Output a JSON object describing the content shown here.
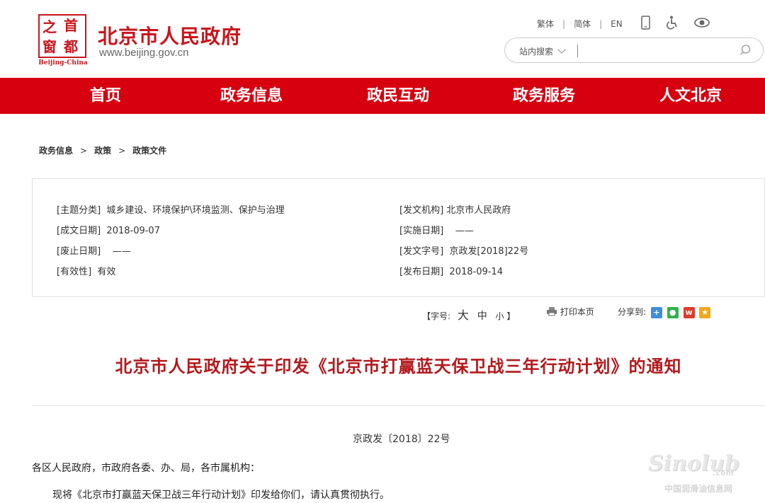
{
  "header": {
    "logo": {
      "char_1": "之",
      "char_2": "首",
      "char_3": "窗",
      "char_4": "都",
      "en": "Beijing-China"
    },
    "title": "北京市人民政府",
    "url": "www.beijing.gov.cn",
    "links": {
      "traditional": "繁体",
      "simplified": "简体",
      "english": "EN"
    },
    "icons": [
      "mobile-icon",
      "accessibility-icon",
      "eye-icon"
    ],
    "search": {
      "scope": "站内搜索",
      "value": "",
      "placeholder": ""
    }
  },
  "nav": {
    "items": [
      "首页",
      "政务信息",
      "政民互动",
      "政务服务",
      "人文北京"
    ]
  },
  "breadcrumb": [
    "政务信息",
    "政策",
    "政策文件"
  ],
  "meta": {
    "topic_label": "[主题分类]",
    "topic_value": "城乡建设、环境保护\\环境监测、保护与治理",
    "issuer_label": "[发文机构]",
    "issuer_value": "北京市人民政府",
    "created_label": "[成文日期]",
    "created_value": "2018-09-07",
    "effective_label": "[实施日期]",
    "effective_value": "——",
    "abolished_label": "[废止日期]",
    "abolished_value": "——",
    "docno_label": "[发文字号]",
    "docno_value": "京政发[2018]22号",
    "validity_label": "[有效性]",
    "validity_value": "有效",
    "published_label": "[发布日期]",
    "published_value": "2018-09-14"
  },
  "tools": {
    "font_open": "【字号:",
    "font_large": "大",
    "font_medium": "中",
    "font_small": "小",
    "font_close": "】",
    "print": "打印本页",
    "share": "分享到:"
  },
  "article": {
    "title": "北京市人民政府关于印发《北京市打赢蓝天保卫战三年行动计划》的通知",
    "doc_number": "京政发〔2018〕22号",
    "recipients": "各区人民政府，市政府各委、办、局，各市属机构：",
    "body": "现将《北京市打赢蓝天保卫战三年行动计划》印发给你们，请认真贯彻执行。"
  },
  "watermark": {
    "brand": "Sinolub",
    "domain": ".com",
    "name": "中国润滑油信息网"
  },
  "colors": {
    "brand_red": "#d7000f",
    "title_red": "#b4191c"
  }
}
